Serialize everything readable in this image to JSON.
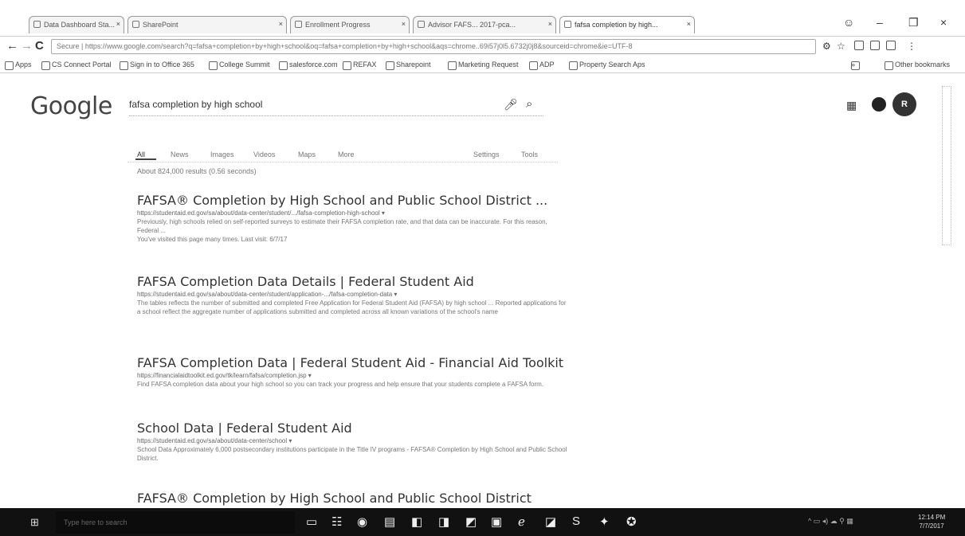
{
  "browser": {
    "tabs": [
      {
        "label": "Data Dashboard Sta..."
      },
      {
        "label": "SharePoint"
      },
      {
        "label": "Enrollment Progress"
      },
      {
        "label": "Advisor FAFS... 2017-pca..."
      },
      {
        "label": "fafsa completion by high..."
      }
    ],
    "window_controls": {
      "minimize": "–",
      "maximize": "❐",
      "close": "×"
    },
    "nav": {
      "back": "←",
      "forward": "→",
      "reload": "C"
    },
    "address": "Secure | https://www.google.com/search?q=fafsa+completion+by+high+school&oq=fafsa+completion+by+high+school&aqs=chrome..69i57j0l5.6732j0j8&sourceid=chrome&ie=UTF-8",
    "bookmarks": [
      "Apps",
      "CS Connect Portal",
      "Sign in to Office 365",
      "College Summit",
      "salesforce.com",
      "REFAX",
      "Sharepoint",
      "Marketing Request",
      "ADP",
      "Property Search Aps"
    ],
    "other_bookmarks": "Other bookmarks"
  },
  "google": {
    "logo": "Google",
    "query": "fafsa completion by high school",
    "search_tabs": [
      "All",
      "News",
      "Images",
      "Videos",
      "Maps",
      "More"
    ],
    "settings": "Settings",
    "tools": "Tools",
    "stats": "About 824,000 results (0.56 seconds)",
    "avatar_initials": "R"
  },
  "results": [
    {
      "title": "FAFSA® Completion by High School and Public School District ...",
      "url": "https://studentaid.ed.gov/sa/about/data-center/student/.../fafsa-completion-high-school ▾",
      "snippet": "Previously, high schools relied on self-reported surveys to estimate their FAFSA completion rate, and that data can be inaccurate. For this reason, Federal ...",
      "extra": "You've visited this page many times. Last visit: 6/7/17"
    },
    {
      "title": "FAFSA Completion Data Details | Federal Student Aid",
      "url": "https://studentaid.ed.gov/sa/about/data-center/student/application-.../fafsa-completion-data ▾",
      "snippet": "The tables reflects the number of submitted and completed Free Application for Federal Student Aid (FAFSA) by high school ... Reported applications for a school reflect the aggregate number of applications submitted and completed across all known variations of the school's name",
      "extra": ""
    },
    {
      "title": "FAFSA Completion Data | Federal Student Aid - Financial Aid Toolkit",
      "url": "https://financialaidtoolkit.ed.gov/tk/learn/fafsa/completion.jsp ▾",
      "snippet": "Find FAFSA completion data about your high school so you can track your progress and help ensure that your students complete a FAFSA form.",
      "extra": ""
    },
    {
      "title": "School Data | Federal Student Aid",
      "url": "https://studentaid.ed.gov/sa/about/data-center/school ▾",
      "snippet": "School Data Approximately 6,000 postsecondary institutions participate in the Title IV programs - FAFSA® Completion by High School and Public School District.",
      "extra": ""
    },
    {
      "title": "FAFSA® Completion by High School and Public School District",
      "url": "",
      "snippet": "",
      "extra": ""
    }
  ],
  "taskbar": {
    "search_placeholder": "Type here to search",
    "clock_time": "12:14 PM",
    "clock_date": "7/7/2017"
  }
}
